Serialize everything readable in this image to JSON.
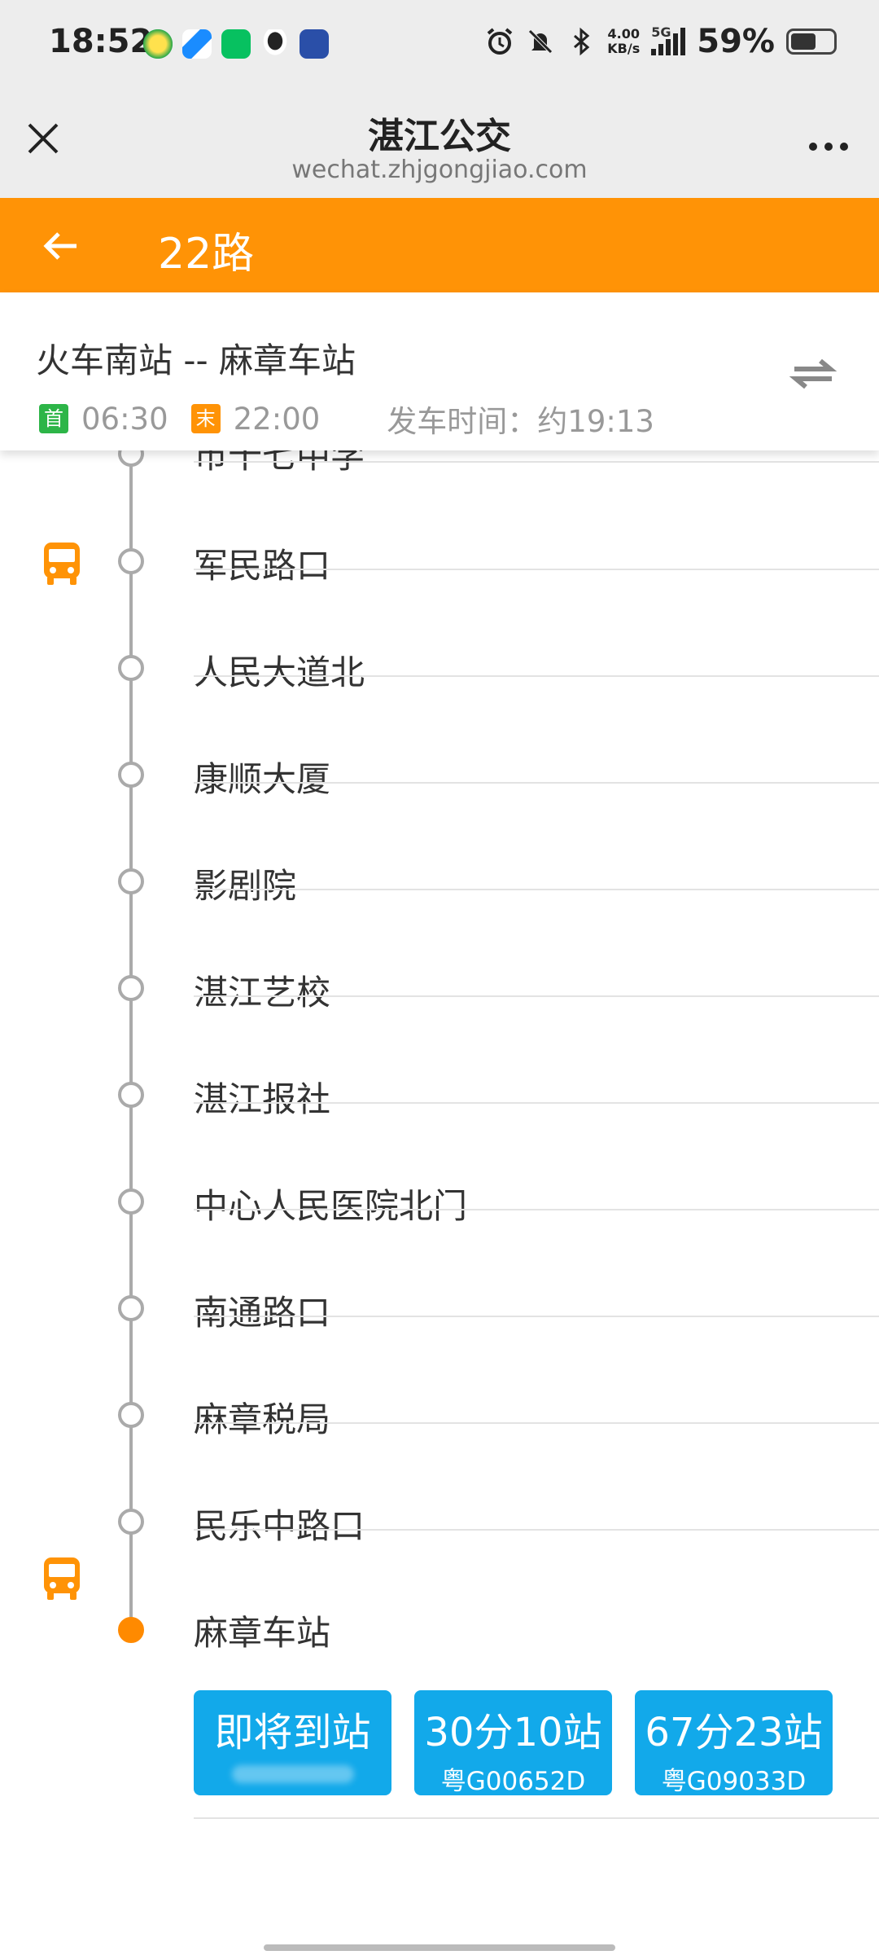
{
  "status_bar": {
    "time": "18:52",
    "net_speed_value": "4.00",
    "net_speed_unit": "KB/s",
    "network": "5G",
    "battery": "59%",
    "battery_level": 0.59,
    "icons": [
      "app-icon-1",
      "app-icon-2",
      "wechat-icon",
      "qq-icon",
      "news-app-icon",
      "alarm-icon",
      "mute-icon",
      "bluetooth-icon",
      "signal-icon",
      "battery-icon"
    ]
  },
  "titlebar": {
    "title": "湛江公交",
    "url": "wechat.zhjgongjiao.com"
  },
  "header": {
    "route": "22路",
    "accent": "#ff9306"
  },
  "route_info": {
    "name": "火车南站 -- 麻章车站",
    "first_tag": "首",
    "first_time": "06:30",
    "last_tag": "末",
    "last_time": "22:00",
    "departure": "发车时间：约19:13"
  },
  "stops": [
    {
      "name": "市十七中学"
    },
    {
      "name": "军民路口"
    },
    {
      "name": "人民大道北"
    },
    {
      "name": "康顺大厦"
    },
    {
      "name": "影剧院"
    },
    {
      "name": "湛江艺校"
    },
    {
      "name": "湛江报社"
    },
    {
      "name": "中心人民医院北门"
    },
    {
      "name": "南通路口"
    },
    {
      "name": "麻章税局"
    },
    {
      "name": "民乐中路口"
    },
    {
      "name": "麻章车站"
    }
  ],
  "arrivals": [
    {
      "main": "即将到站",
      "plate": ""
    },
    {
      "main": "30分10站",
      "plate": "粤G00652D"
    },
    {
      "main": "67分23站",
      "plate": "粤G09033D"
    }
  ],
  "colors": {
    "arrival_button": "#12a9ea",
    "first_tag": "#2db548",
    "last_tag": "#ff9306",
    "end_stop_dot": "#ff8a00"
  }
}
